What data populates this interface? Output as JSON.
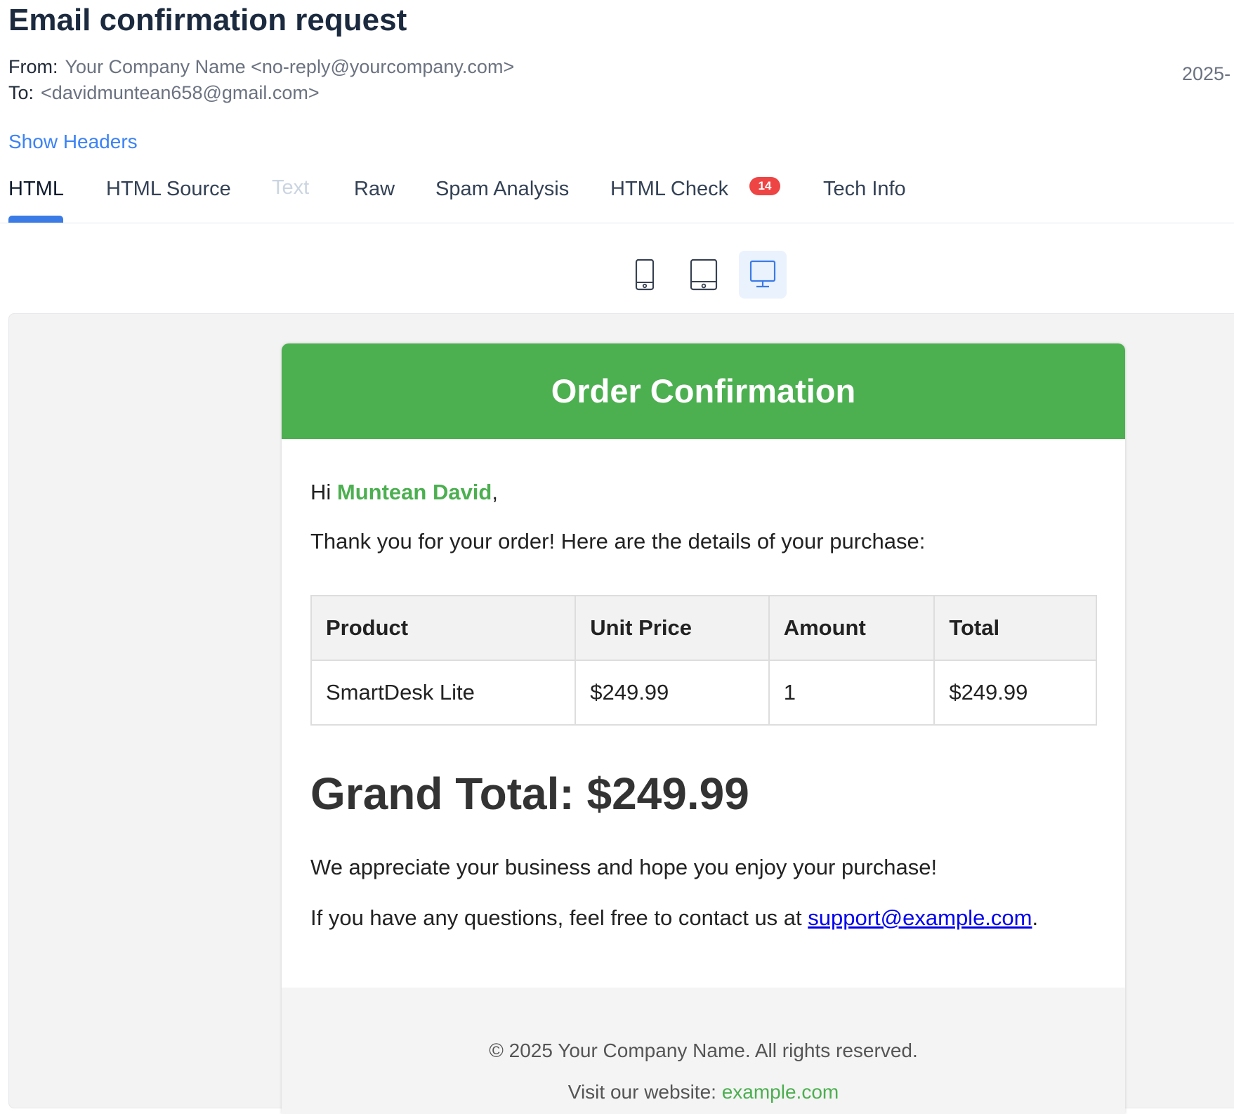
{
  "email": {
    "subject": "Email confirmation request",
    "from_label": "From:",
    "from_value": "Your Company Name <no-reply@yourcompany.com>",
    "to_label": "To:",
    "to_value": "<davidmuntean658@gmail.com>",
    "date": "2025-",
    "show_headers": "Show Headers"
  },
  "tabs": [
    {
      "label": "HTML",
      "active": true
    },
    {
      "label": "HTML Source"
    },
    {
      "label": "Text",
      "disabled": true
    },
    {
      "label": "Raw"
    },
    {
      "label": "Spam Analysis"
    },
    {
      "label": "HTML Check",
      "badge": "14"
    },
    {
      "label": "Tech Info"
    }
  ],
  "device_toggle": [
    {
      "icon": "mobile-icon"
    },
    {
      "icon": "tablet-icon"
    },
    {
      "icon": "desktop-icon",
      "active": true
    }
  ],
  "message": {
    "header": "Order Confirmation",
    "greeting_prefix": "Hi ",
    "customer_name": "Muntean David",
    "greeting_suffix": ",",
    "intro": "Thank you for your order! Here are the details of your purchase:",
    "table": {
      "headers": [
        "Product",
        "Unit Price",
        "Amount",
        "Total"
      ],
      "rows": [
        [
          "SmartDesk Lite",
          "$249.99",
          "1",
          "$249.99"
        ]
      ]
    },
    "grand_total": "Grand Total: $249.99",
    "appreciation": "We appreciate your business and hope you enjoy your purchase!",
    "contact_prefix": "If you have any questions, feel free to contact us at ",
    "contact_email": "support@example.com",
    "contact_suffix": ".",
    "footer_copyright": "© 2025 Your Company Name. All rights reserved.",
    "footer_visit_prefix": "Visit our website: ",
    "footer_site": "example.com"
  },
  "colors": {
    "brand_green": "#4caf50",
    "link_blue": "#3b82f6",
    "badge_red": "#ef4444",
    "active_tab_underline": "#3b7be6"
  }
}
